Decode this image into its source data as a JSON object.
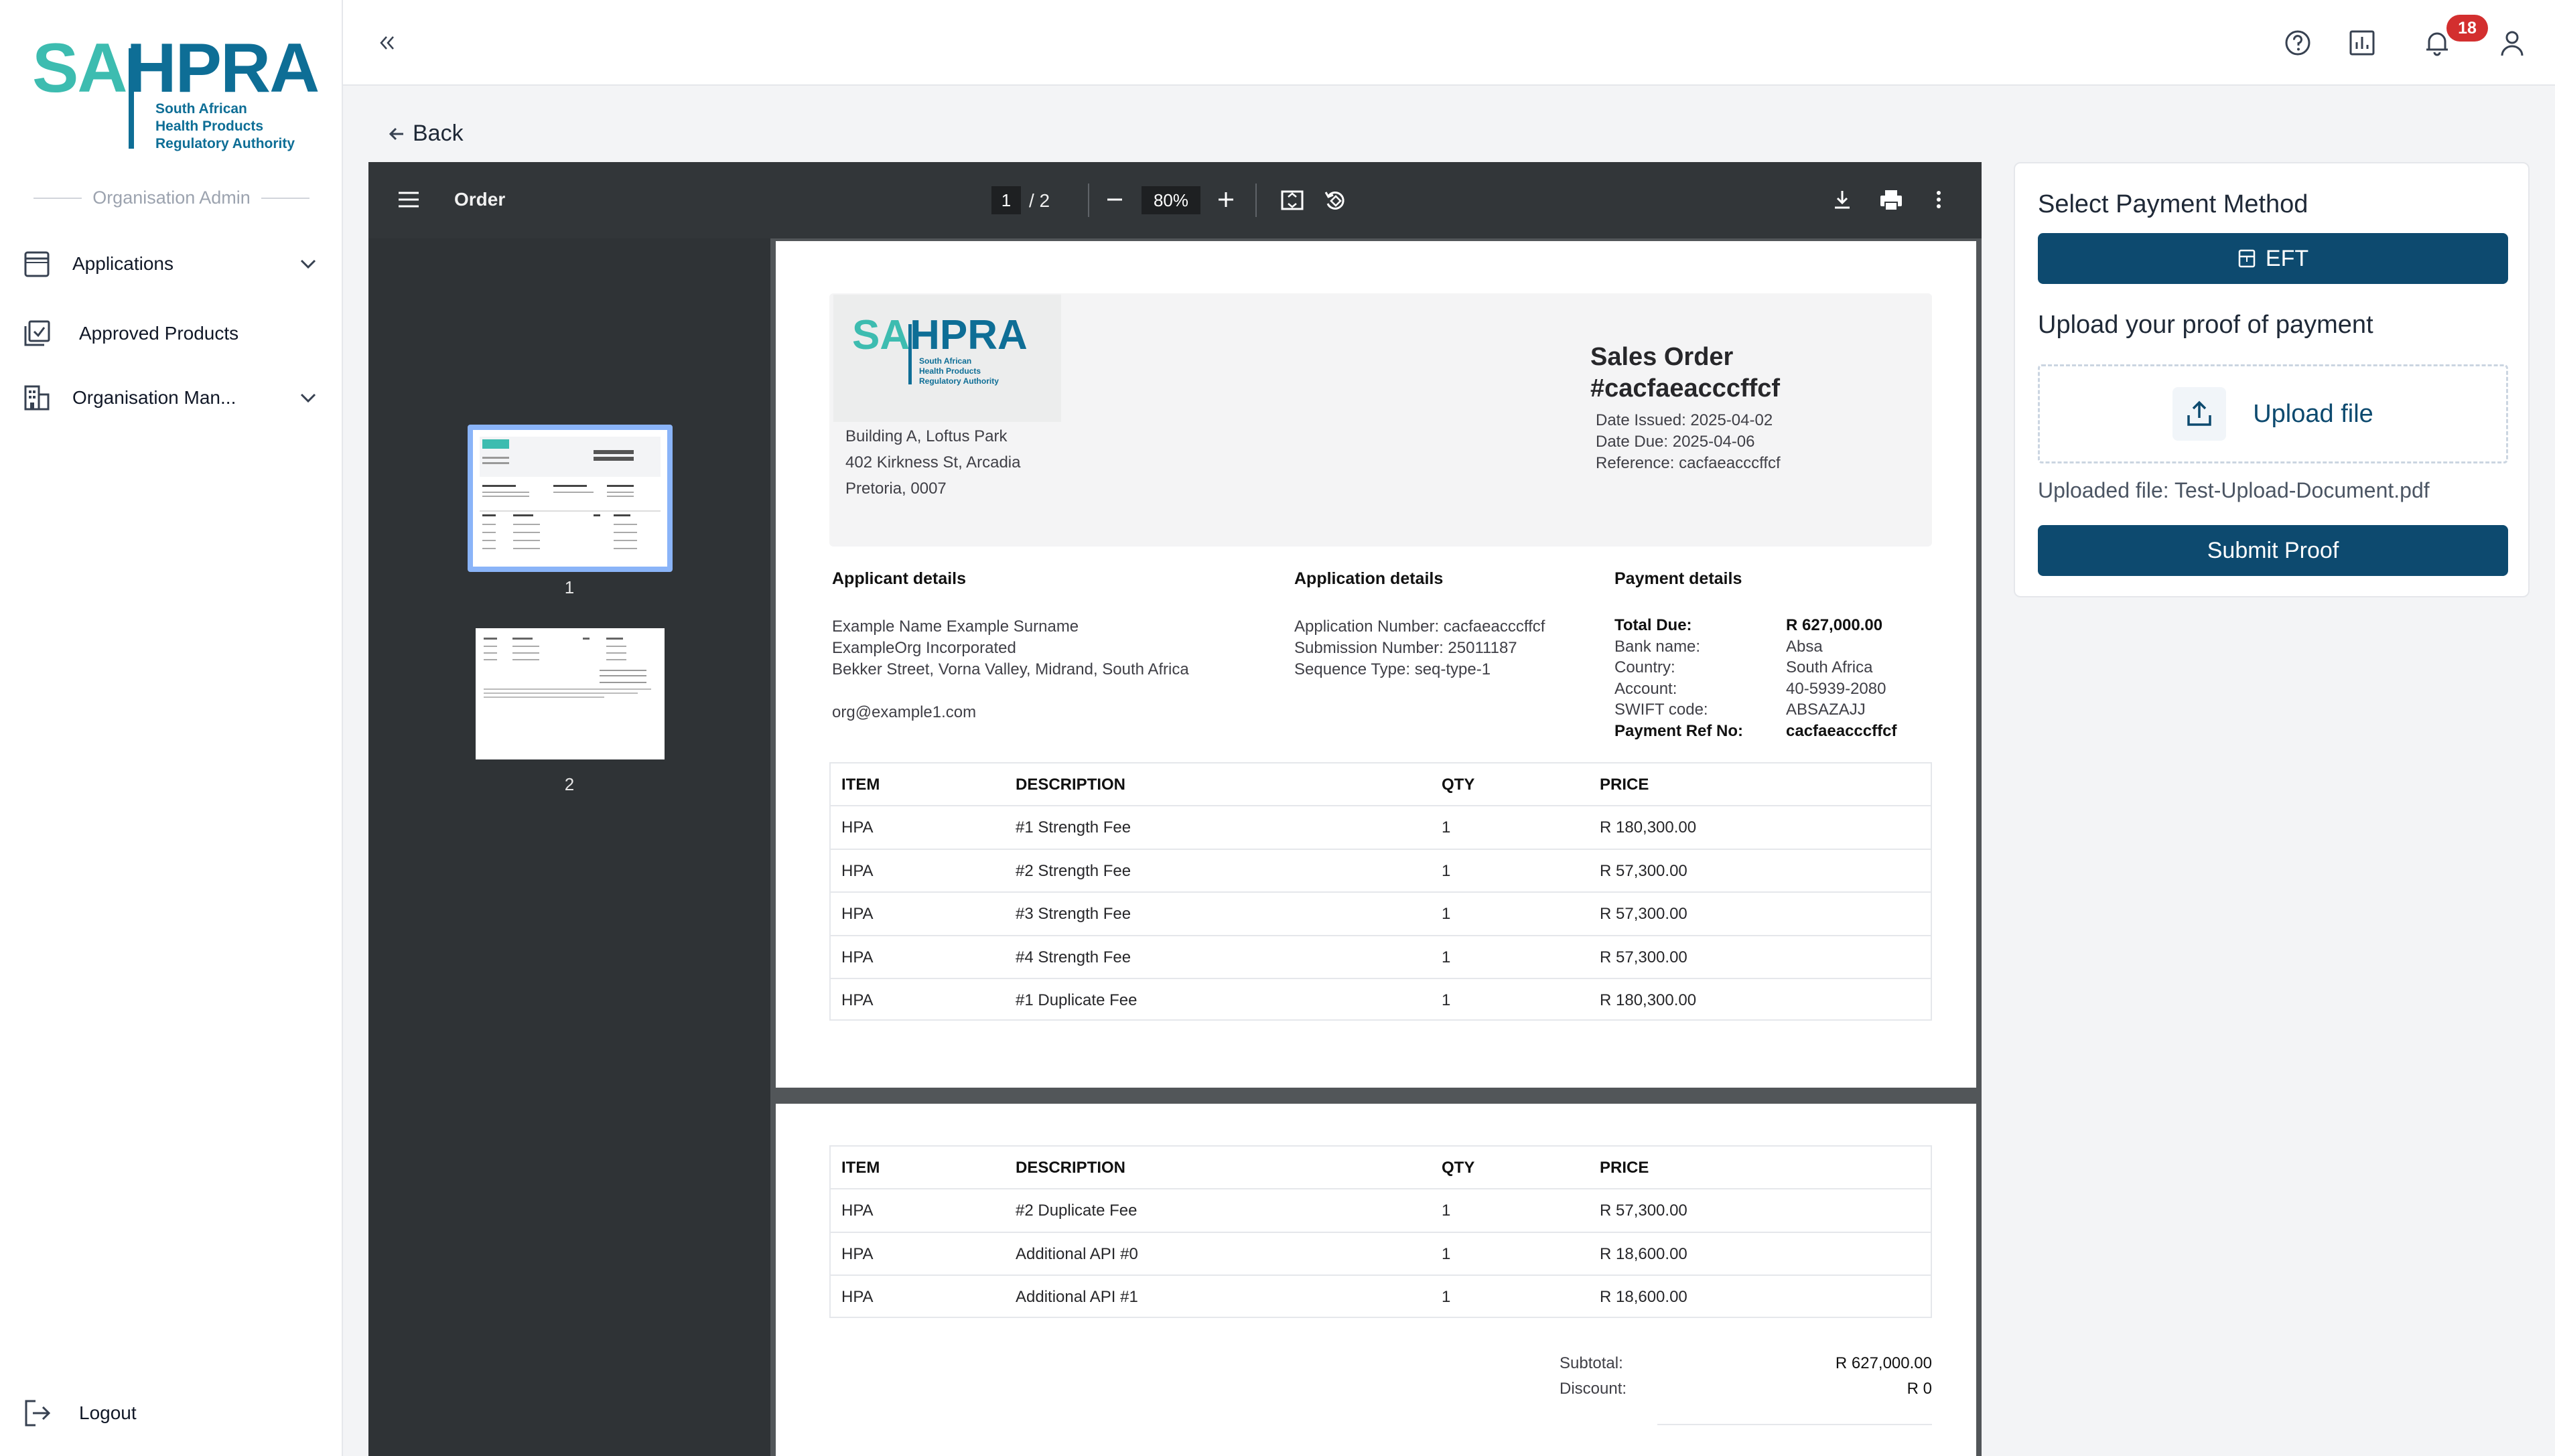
{
  "sidebar": {
    "logo": {
      "brand_sa": "SA",
      "brand_hpra": "HPRA",
      "line1": "South African",
      "line2": "Health Products",
      "line3": "Regulatory Authority"
    },
    "section_label": "Organisation Admin",
    "items": [
      {
        "label": "Applications",
        "icon": "applications-icon",
        "has_chevron": true
      },
      {
        "label": "Approved Products",
        "icon": "approved-products-icon",
        "has_chevron": false
      },
      {
        "label": "Organisation Man...",
        "icon": "organisation-icon",
        "has_chevron": true
      }
    ],
    "logout_label": "Logout"
  },
  "header": {
    "collapse_icon": "double-chevron-left-icon",
    "icons": [
      "help-icon",
      "reports-icon",
      "bell-icon",
      "user-icon"
    ],
    "notification_count": "18"
  },
  "back_label": "Back",
  "viewer": {
    "title": "Order",
    "current_page": "1",
    "total_pages": "/ 2",
    "zoom": "80%",
    "thumbnails": [
      {
        "label": "1"
      },
      {
        "label": "2"
      }
    ],
    "selected_thumbnail": 1
  },
  "document": {
    "logo": {
      "sa": "SA",
      "hpra": "HPRA",
      "line1": "South African",
      "line2": "Health Products",
      "line3": "Regulatory Authority"
    },
    "address": [
      "Building A, Loftus Park",
      "402 Kirkness St, Arcadia",
      "Pretoria, 0007"
    ],
    "title_line1": "Sales Order",
    "title_line2": "#cacfaeacccffcf",
    "date_issued": "Date Issued: 2025-04-02",
    "date_due": "Date Due: 2025-04-06",
    "reference": "Reference: cacfaeacccffcf",
    "applicant": {
      "heading": "Applicant details",
      "name": "Example Name Example Surname",
      "org": "ExampleOrg Incorporated",
      "address": "Bekker Street, Vorna Valley, Midrand, South Africa",
      "email": "org@example1.com"
    },
    "application": {
      "heading": "Application details",
      "number": "Application Number: cacfaeacccffcf",
      "submission": "Submission Number: 25011187",
      "sequence": "Sequence Type: seq-type-1"
    },
    "payment": {
      "heading": "Payment details",
      "rows": [
        {
          "label": "Total Due:",
          "value": "R 627,000.00",
          "bold": true
        },
        {
          "label": "Bank name:",
          "value": "Absa",
          "bold": false
        },
        {
          "label": "Country:",
          "value": "South Africa",
          "bold": false
        },
        {
          "label": "Account:",
          "value": "40-5939-2080",
          "bold": false
        },
        {
          "label": "SWIFT code:",
          "value": "ABSAZAJJ",
          "bold": false
        },
        {
          "label": "Payment Ref No:",
          "value": "cacfaeacccffcf",
          "bold": true
        }
      ]
    },
    "table_headers": [
      "ITEM",
      "DESCRIPTION",
      "QTY",
      "PRICE"
    ],
    "page1_rows": [
      [
        "HPA",
        "#1 Strength Fee",
        "1",
        "R 180,300.00"
      ],
      [
        "HPA",
        "#2 Strength Fee",
        "1",
        "R 57,300.00"
      ],
      [
        "HPA",
        "#3 Strength Fee",
        "1",
        "R 57,300.00"
      ],
      [
        "HPA",
        "#4 Strength Fee",
        "1",
        "R 57,300.00"
      ],
      [
        "HPA",
        "#1 Duplicate Fee",
        "1",
        "R 180,300.00"
      ]
    ],
    "page2_rows": [
      [
        "HPA",
        "#2 Duplicate Fee",
        "1",
        "R 57,300.00"
      ],
      [
        "HPA",
        "Additional API #0",
        "1",
        "R 18,600.00"
      ],
      [
        "HPA",
        "Additional API #1",
        "1",
        "R 18,600.00"
      ]
    ],
    "subtotal_label": "Subtotal:",
    "subtotal_value": "R 627,000.00",
    "discount_label": "Discount:",
    "discount_value": "R 0"
  },
  "payment_panel": {
    "title": "Select Payment Method",
    "method_label": "EFT",
    "upload_title": "Upload your proof of payment",
    "upload_button": "Upload file",
    "uploaded_file": "Uploaded file: Test-Upload-Document.pdf",
    "submit_label": "Submit Proof"
  },
  "colors": {
    "primary": "#0d4a6f",
    "brand_teal": "#3dbcb0",
    "brand_blue": "#0e6e96",
    "badge": "#d32f2f"
  }
}
